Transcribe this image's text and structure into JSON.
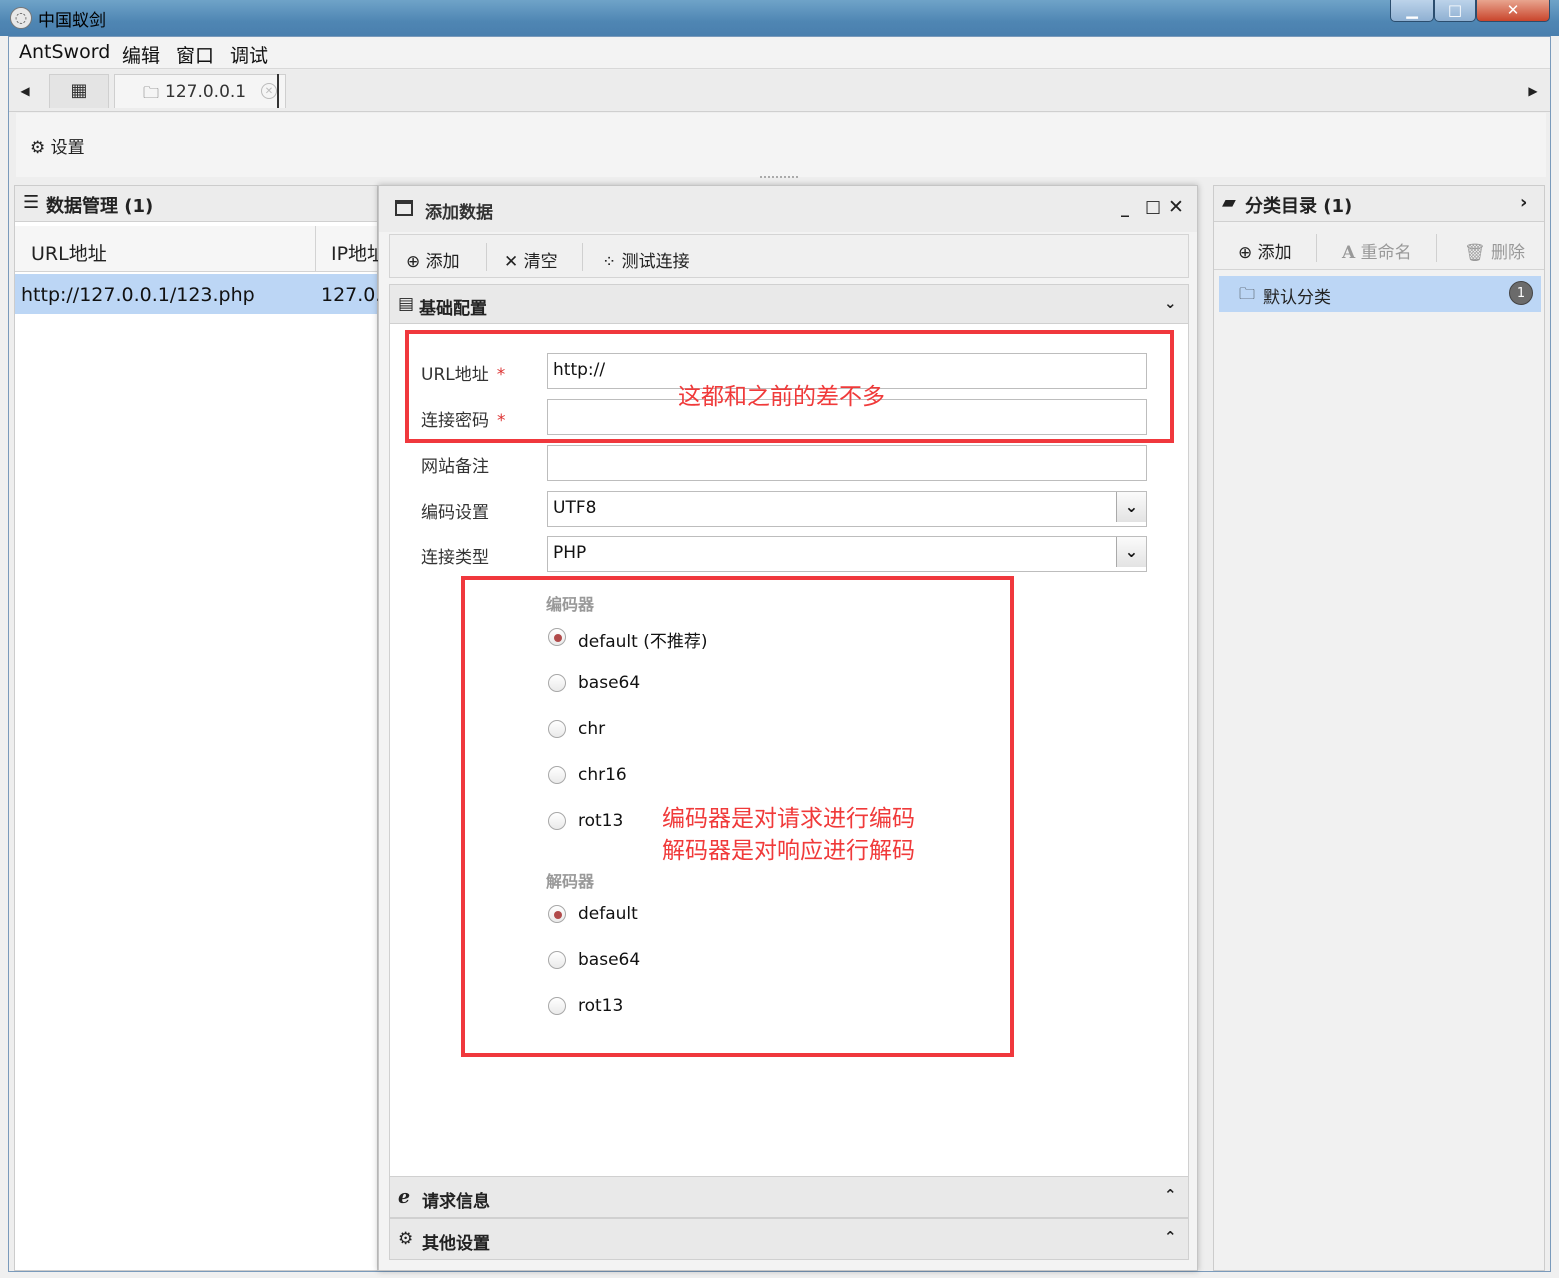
{
  "window": {
    "title": "中国蚁剑"
  },
  "menu": [
    "AntSword",
    "编辑",
    "窗口",
    "调试"
  ],
  "tabs": {
    "ip_tab": "127.0.0.1"
  },
  "toolbar": {
    "settings": "设置"
  },
  "data_panel": {
    "title": "数据管理 (1)",
    "columns": [
      "URL地址",
      "IP地址"
    ],
    "rows": [
      {
        "url": "http://127.0.0.1/123.php",
        "ip": "127.0."
      }
    ]
  },
  "dialog": {
    "title": "添加数据",
    "actions": {
      "add": "添加",
      "clear": "清空",
      "test": "测试连接"
    },
    "section_basic": "基础配置",
    "fields": {
      "url_label": "URL地址",
      "url_value": "http://",
      "password_label": "连接密码",
      "password_value": "",
      "note_label": "网站备注",
      "note_value": "",
      "encoding_label": "编码设置",
      "encoding_value": "UTF8",
      "type_label": "连接类型",
      "type_value": "PHP"
    },
    "encoder_group": "编码器",
    "encoders": [
      "default (不推荐)",
      "base64",
      "chr",
      "chr16",
      "rot13"
    ],
    "encoder_selected": 0,
    "decoder_group": "解码器",
    "decoders": [
      "default",
      "base64",
      "rot13"
    ],
    "decoder_selected": 0,
    "section_request": "请求信息",
    "section_other": "其他设置"
  },
  "annotations": {
    "note1": "这都和之前的差不多",
    "note2_line1": "编码器是对请求进行编码",
    "note2_line2": "解码器是对响应进行解码"
  },
  "category_panel": {
    "title": "分类目录 (1)",
    "actions": {
      "add": "添加",
      "rename": "重命名",
      "delete": "删除"
    },
    "items": [
      {
        "name": "默认分类",
        "count": "1"
      }
    ]
  },
  "colors": {
    "annotation": "#f0383d",
    "selection": "#bcd6f5"
  }
}
